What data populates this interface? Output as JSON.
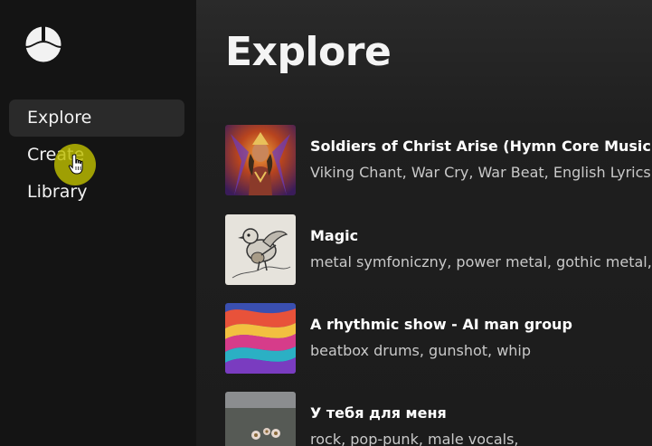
{
  "sidebar": {
    "logo": "suno-wave-logo",
    "items": [
      {
        "label": "Explore",
        "active": true
      },
      {
        "label": "Create",
        "active": false
      },
      {
        "label": "Library",
        "active": false
      }
    ]
  },
  "main": {
    "title": "Explore",
    "tracks": [
      {
        "title": "Soldiers of Christ Arise (Hymn Core Music) ✝",
        "tags": "Viking Chant, War Cry, War Beat, English Lyrics",
        "cover": "warrior-goddess-art"
      },
      {
        "title": "Magic",
        "tags": "metal symfoniczny, power metal, gothic metal, h",
        "cover": "bird-with-lute-sketch"
      },
      {
        "title": "A rhythmic show - AI man group",
        "tags": "beatbox drums, gunshot, whip",
        "cover": "swirling-color-art"
      },
      {
        "title": "У тебя для меня",
        "tags": "rock, pop-punk, male vocals,",
        "cover": "flowers-in-field-photo"
      }
    ]
  },
  "colors": {
    "sidebar_bg": "#141414",
    "main_bg": "#1d1d1d",
    "active_item_bg": "#2a2a2a",
    "cursor_highlight": "#bebe00"
  }
}
